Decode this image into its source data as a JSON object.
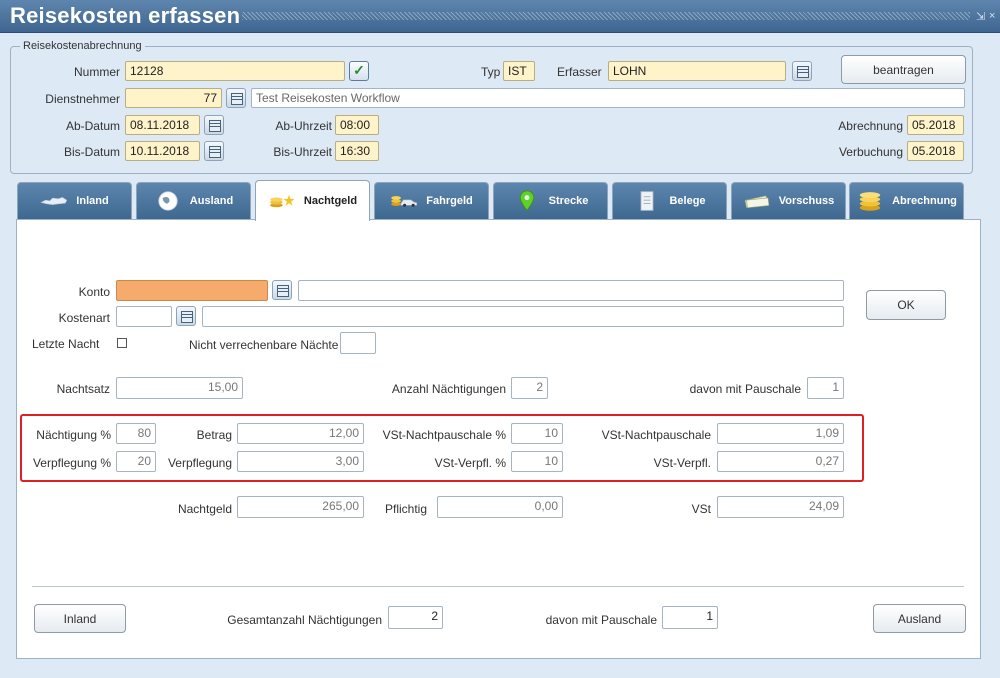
{
  "window": {
    "title": "Reisekosten erfassen"
  },
  "header": {
    "group_label": "Reisekostenabrechnung",
    "nummer_label": "Nummer",
    "nummer_value": "12128",
    "typ_label": "Typ",
    "typ_value": "IST",
    "erfasser_label": "Erfasser",
    "erfasser_value": "LOHN",
    "beantragen_label": "beantragen",
    "dienstnehmer_label": "Dienstnehmer",
    "dienstnehmer_value": "77",
    "dienstnehmer_desc": "Test Reisekosten Workflow",
    "ab_datum_label": "Ab-Datum",
    "ab_datum_value": "08.11.2018",
    "ab_uhrzeit_label": "Ab-Uhrzeit",
    "ab_uhrzeit_value": "08:00",
    "abrechnung_label": "Abrechnung",
    "abrechnung_value": "05.2018",
    "bis_datum_label": "Bis-Datum",
    "bis_datum_value": "10.11.2018",
    "bis_uhrzeit_label": "Bis-Uhrzeit",
    "bis_uhrzeit_value": "16:30",
    "verbuchung_label": "Verbuchung",
    "verbuchung_value": "05.2018"
  },
  "tabs": [
    {
      "label": "Inland",
      "icon": "austria-map-icon"
    },
    {
      "label": "Ausland",
      "icon": "globe-icon"
    },
    {
      "label": "Nachtgeld",
      "icon": "coins-stars-icon",
      "active": true
    },
    {
      "label": "Fahrgeld",
      "icon": "coins-car-icon"
    },
    {
      "label": "Strecke",
      "icon": "map-pin-icon"
    },
    {
      "label": "Belege",
      "icon": "receipt-icon"
    },
    {
      "label": "Vorschuss",
      "icon": "money-bills-icon"
    },
    {
      "label": "Abrechnung",
      "icon": "coins-stack-icon"
    }
  ],
  "form": {
    "konto_label": "Konto",
    "konto_value": "",
    "konto_desc": "",
    "ok_label": "OK",
    "kostenart_label": "Kostenart",
    "kostenart_value": "",
    "kostenart_desc": "",
    "letzte_nacht_label": "Letzte Nacht",
    "nicht_verrechenbar_label": "Nicht verrechenbare Nächte",
    "nicht_verrechenbar_value": "",
    "nachtsatz_label": "Nachtsatz",
    "nachtsatz_value": "15,00",
    "anzahl_label": "Anzahl Nächtigungen",
    "anzahl_value": "2",
    "davon_label": "davon mit Pauschale",
    "davon_value": "1",
    "naechtigung_pct_label": "Nächtigung %",
    "naechtigung_pct_value": "80",
    "betrag_label": "Betrag",
    "betrag_value": "12,00",
    "vst_nachtpauschale_pct_label": "VSt-Nachtpauschale %",
    "vst_nachtpauschale_pct_value": "10",
    "vst_nachtpauschale_label": "VSt-Nachtpauschale",
    "vst_nachtpauschale_value": "1,09",
    "verpflegung_pct_label": "Verpflegung %",
    "verpflegung_pct_value": "20",
    "verpflegung_label": "Verpflegung",
    "verpflegung_value": "3,00",
    "vst_verpfl_pct_label": "VSt-Verpfl. %",
    "vst_verpfl_pct_value": "10",
    "vst_verpfl_label": "VSt-Verpfl.",
    "vst_verpfl_value": "0,27",
    "nachtgeld_label": "Nachtgeld",
    "nachtgeld_value": "265,00",
    "pflichtig_label": "Pflichtig",
    "pflichtig_value": "0,00",
    "vst_label": "VSt",
    "vst_value": "24,09"
  },
  "footer": {
    "inland_button": "Inland",
    "gesamt_label": "Gesamtanzahl Nächtigungen",
    "gesamt_value": "2",
    "davon_label": "davon mit Pauschale",
    "davon_value": "1",
    "ausland_button": "Ausland"
  },
  "colors": {
    "titlebar": "#4a729a",
    "background": "#dde9f4",
    "required_field": "#fff3c9",
    "konto_field": "#f6ab6c",
    "highlight_box": "#e02020"
  }
}
